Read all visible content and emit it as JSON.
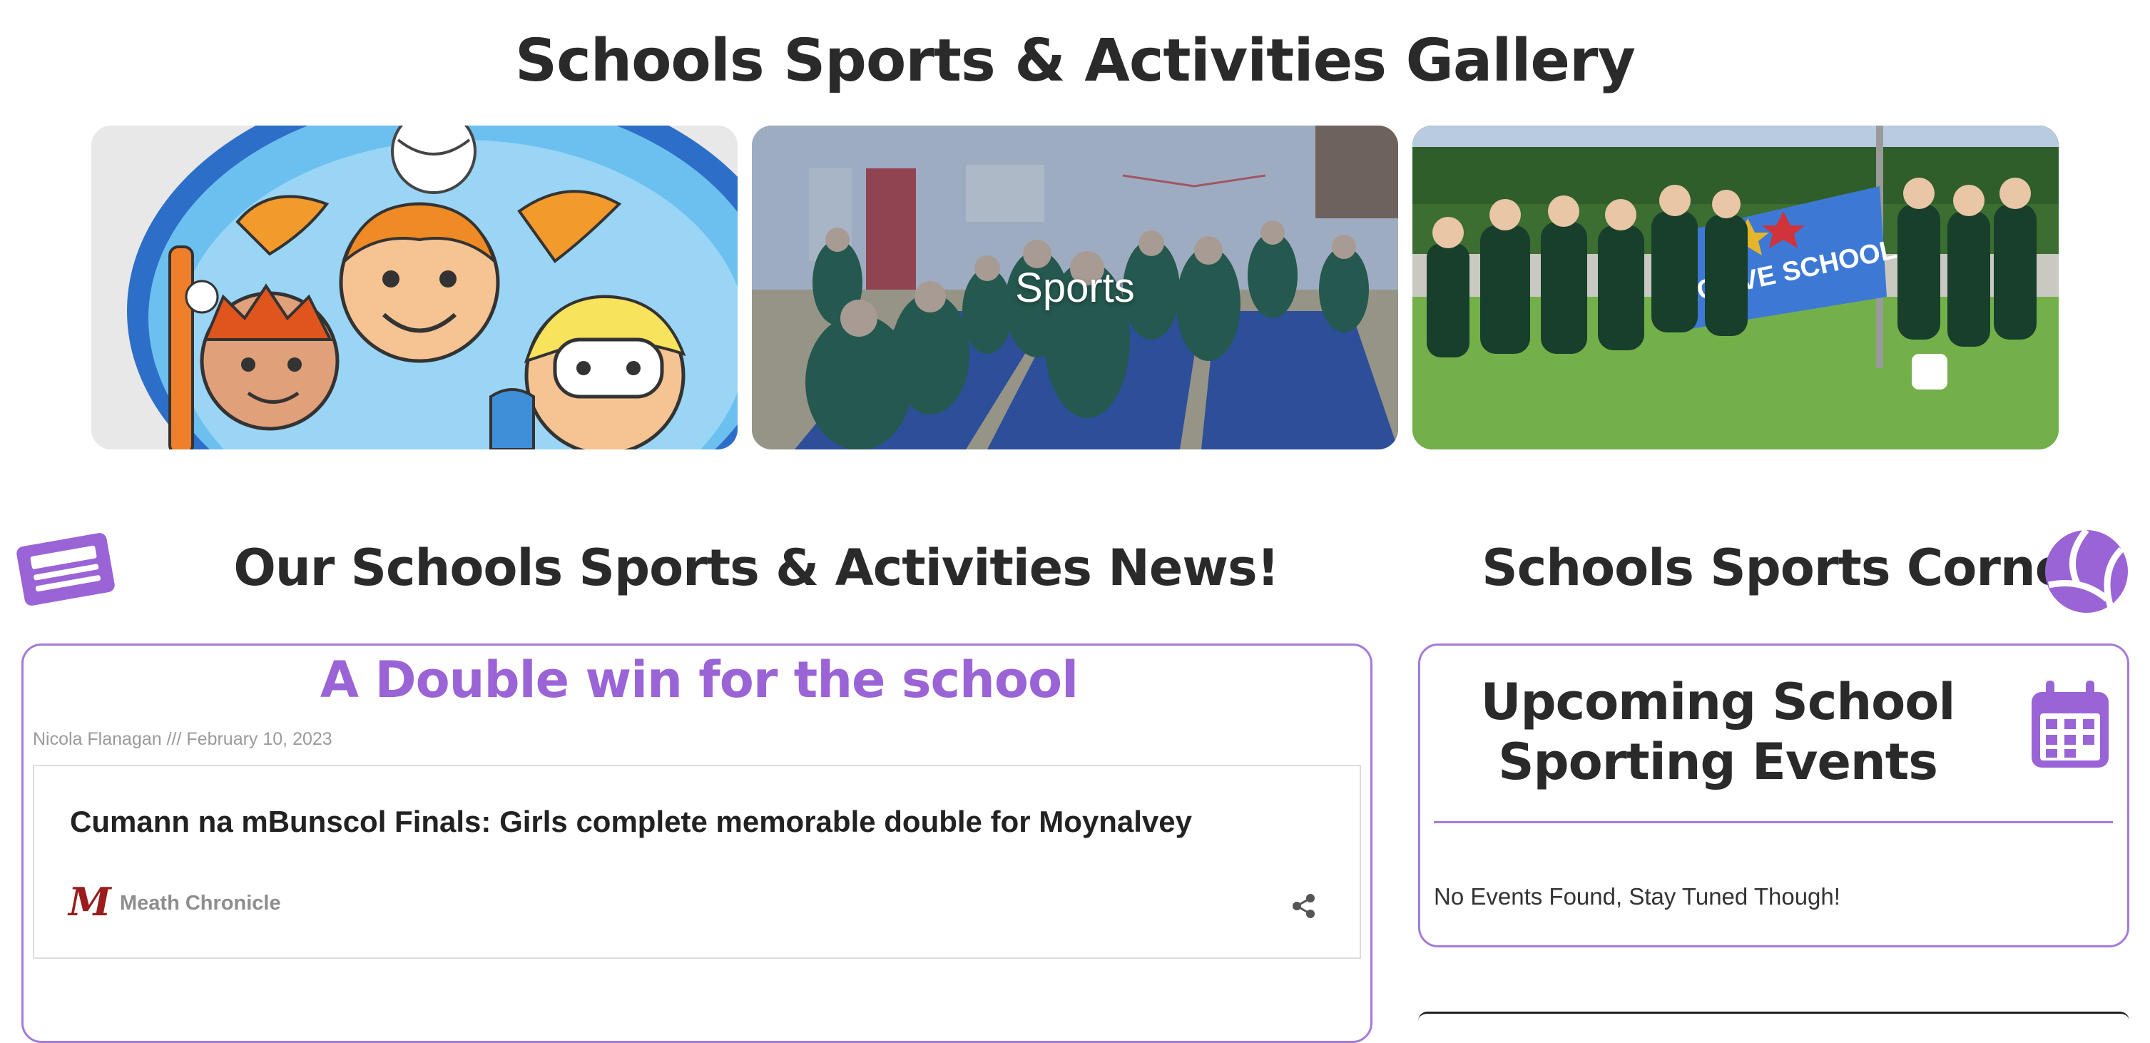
{
  "gallery": {
    "title": "Schools Sports & Activities Gallery",
    "tiles": [
      {
        "caption": ""
      },
      {
        "caption": "Sports"
      },
      {
        "caption": ""
      }
    ],
    "flag_text": "ACTIVE SCHOOL"
  },
  "news": {
    "title": "Our Schools Sports & Activities News!",
    "article": {
      "title": "A Double win for the school",
      "byline": "Nicola Flanagan /// February 10, 2023",
      "embed": {
        "headline": "Cumann na mBunscol Finals: Girls complete memorable double for Moynalvey",
        "source_logo_text": "M",
        "source": "Meath Chronicle"
      }
    }
  },
  "corner": {
    "title": "Schools Sports Corner",
    "events": {
      "title": "Upcoming School Sporting Events",
      "empty_message": "No Events Found, Stay Tuned Though!"
    }
  },
  "colors": {
    "accent": "#9a64d6",
    "border": "#a57ad8"
  },
  "icons": [
    "newspaper-icon",
    "volleyball-icon",
    "calendar-icon",
    "share-icon"
  ]
}
